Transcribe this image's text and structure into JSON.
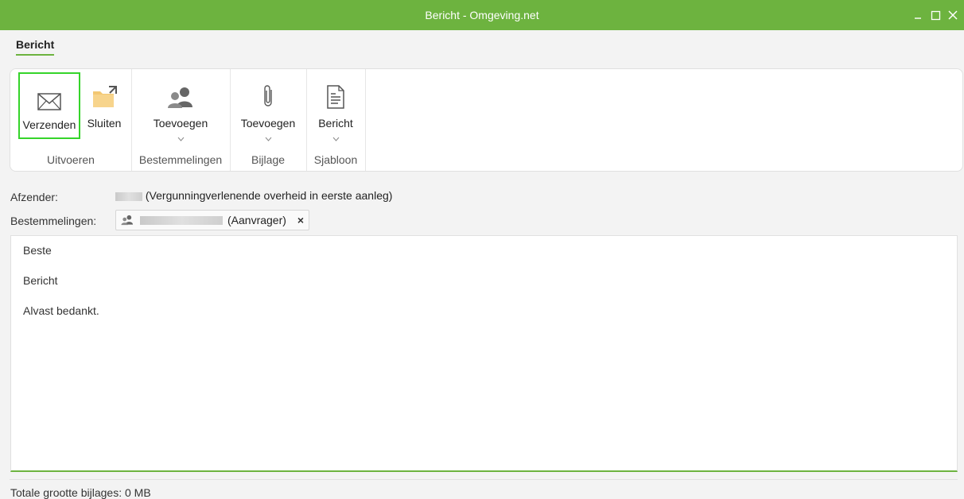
{
  "window": {
    "title": "Bericht - Omgeving.net",
    "accent": "#6db33f",
    "controls": {
      "minimize": "minimize-icon",
      "maximize": "maximize-icon",
      "close": "close-icon"
    }
  },
  "ribbon": {
    "tab": "Bericht",
    "groups": {
      "uitvoeren": {
        "label": "Uitvoeren",
        "send": {
          "label": "Verzenden",
          "icon": "envelope-icon"
        },
        "close": {
          "label": "Sluiten",
          "icon": "folder-icon"
        }
      },
      "bestemmelingen": {
        "label": "Bestemmelingen",
        "add": {
          "label": "Toevoegen",
          "icon": "users-icon"
        }
      },
      "bijlage": {
        "label": "Bijlage",
        "add": {
          "label": "Toevoegen",
          "icon": "paperclip-icon"
        }
      },
      "sjabloon": {
        "label": "Sjabloon",
        "message": {
          "label": "Bericht",
          "icon": "document-icon"
        }
      }
    }
  },
  "form": {
    "sender_label": "Afzender:",
    "sender_role": "(Vergunningverlenende overheid in eerste aanleg)",
    "recipients_label": "Bestemmelingen:",
    "recipient_role": "(Aanvrager)",
    "remove_glyph": "×"
  },
  "editor": {
    "line1": "Beste",
    "line2": "Bericht",
    "line3": "Alvast bedankt."
  },
  "footer": {
    "attachments_size": "Totale grootte bijlages: 0 MB"
  }
}
